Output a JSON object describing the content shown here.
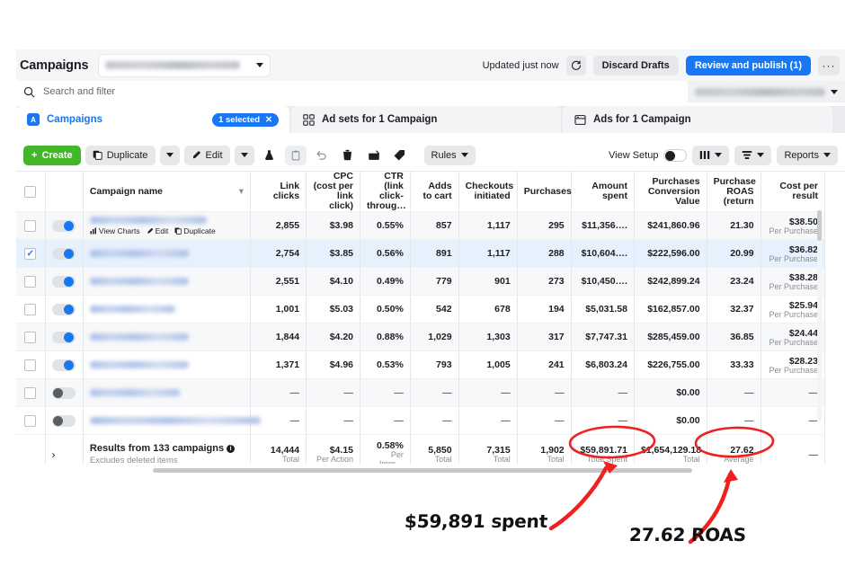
{
  "header": {
    "title": "Campaigns",
    "account_selector_value": "",
    "updated_text": "Updated just now",
    "refresh_icon": "refresh-icon",
    "discard_label": "Discard Drafts",
    "publish_label": "Review and publish (1)",
    "more_label": "···"
  },
  "search": {
    "icon": "search-icon",
    "placeholder": "Search and filter",
    "daterange_value": ""
  },
  "tabs": [
    {
      "label": "Campaigns",
      "icon": "campaigns-icon",
      "badge": "1 selected",
      "badge_close": "✕",
      "active": true
    },
    {
      "label": "Ad sets for 1 Campaign",
      "icon": "adsets-icon",
      "active": false
    },
    {
      "label": "Ads for 1 Campaign",
      "icon": "ads-icon",
      "active": false
    }
  ],
  "toolbar": {
    "create_label": "Create",
    "create_icon": "plus-icon",
    "duplicate_label": "Duplicate",
    "duplicate_icon": "duplicate-icon",
    "edit_label": "Edit",
    "edit_icon": "pencil-icon",
    "ab_test_icon": "ab-test-flask-icon",
    "copy_icon": "clipboard-icon",
    "undo_icon": "undo-icon",
    "delete_icon": "trash-icon",
    "export_icon": "export-icon",
    "tag_icon": "tag-icon",
    "rules_label": "Rules",
    "view_setup_label": "View Setup",
    "view_setup_on": true,
    "columns_icon": "columns-icon",
    "breakdown_icon": "breakdown-icon",
    "reports_label": "Reports"
  },
  "table": {
    "columns": [
      "Campaign name",
      "Link clicks",
      "CPC (cost per link click)",
      "CTR (link click-throug…",
      "Adds to cart",
      "Checkouts initiated",
      "Purchases",
      "Amount spent",
      "Purchases Conversion Value",
      "Purchase ROAS (return",
      "Cost per result"
    ],
    "hover_actions": [
      {
        "label": "View Charts",
        "icon": "bar-chart-icon"
      },
      {
        "label": "Edit",
        "icon": "pencil-icon"
      },
      {
        "label": "Duplicate",
        "icon": "duplicate-icon"
      }
    ],
    "rows": [
      {
        "selected": false,
        "toggle": "on",
        "name": "",
        "cells": [
          "2,855",
          "$3.98",
          "0.55%",
          "857",
          "1,117",
          "295",
          "$11,356….",
          "$241,860.96",
          "21.30",
          "$38.50"
        ],
        "cost_sub": "Per Purchase",
        "hovered": true
      },
      {
        "selected": true,
        "toggle": "on",
        "name": "",
        "cells": [
          "2,754",
          "$3.85",
          "0.56%",
          "891",
          "1,117",
          "288",
          "$10,604….",
          "$222,596.00",
          "20.99",
          "$36.82"
        ],
        "cost_sub": "Per Purchase"
      },
      {
        "selected": false,
        "toggle": "on",
        "name": "",
        "cells": [
          "2,551",
          "$4.10",
          "0.49%",
          "779",
          "901",
          "273",
          "$10,450….",
          "$242,899.24",
          "23.24",
          "$38.28"
        ],
        "cost_sub": "Per Purchase"
      },
      {
        "selected": false,
        "toggle": "on",
        "name": "",
        "cells": [
          "1,001",
          "$5.03",
          "0.50%",
          "542",
          "678",
          "194",
          "$5,031.58",
          "$162,857.00",
          "32.37",
          "$25.94"
        ],
        "cost_sub": "Per Purchase"
      },
      {
        "selected": false,
        "toggle": "on",
        "name": "",
        "cells": [
          "1,844",
          "$4.20",
          "0.88%",
          "1,029",
          "1,303",
          "317",
          "$7,747.31",
          "$285,459.00",
          "36.85",
          "$24.44"
        ],
        "cost_sub": "Per Purchase"
      },
      {
        "selected": false,
        "toggle": "on",
        "name": "",
        "cells": [
          "1,371",
          "$4.96",
          "0.53%",
          "793",
          "1,005",
          "241",
          "$6,803.24",
          "$226,755.00",
          "33.33",
          "$28.23"
        ],
        "cost_sub": "Per Purchase"
      },
      {
        "selected": false,
        "toggle": "off",
        "name": "",
        "cells": [
          "—",
          "—",
          "—",
          "—",
          "—",
          "—",
          "—",
          "$0.00",
          "—",
          "—"
        ],
        "cost_sub": ""
      },
      {
        "selected": false,
        "toggle": "off",
        "name": "",
        "cells": [
          "—",
          "—",
          "—",
          "—",
          "—",
          "—",
          "—",
          "$0.00",
          "—",
          "—"
        ],
        "cost_sub": ""
      }
    ],
    "totals": {
      "expand_icon": "chevron-right-icon",
      "title": "Results from 133 campaigns",
      "subtitle": "Excludes deleted items",
      "info_icon": "info-icon",
      "values": [
        {
          "v": "14,444",
          "s": "Total"
        },
        {
          "v": "$4.15",
          "s": "Per Action"
        },
        {
          "v": "0.58%",
          "s": "Per Impr…"
        },
        {
          "v": "5,850",
          "s": "Total"
        },
        {
          "v": "7,315",
          "s": "Total"
        },
        {
          "v": "1,902",
          "s": "Total"
        },
        {
          "v": "$59,891.71",
          "s": "Total Spent"
        },
        {
          "v": "$1,654,129.18",
          "s": "Total"
        },
        {
          "v": "27.62",
          "s": "Average"
        },
        {
          "v": "—",
          "s": ""
        }
      ]
    }
  },
  "annotations": [
    {
      "text": "$59,891 spent",
      "name": "annotation-spent"
    },
    {
      "text": "27.62 ROAS",
      "name": "annotation-roas"
    }
  ],
  "colors": {
    "brand_blue": "#1877f2",
    "create_green": "#42b72a",
    "annotation_red": "#ef2020",
    "selected_row": "#e7f0fd"
  }
}
